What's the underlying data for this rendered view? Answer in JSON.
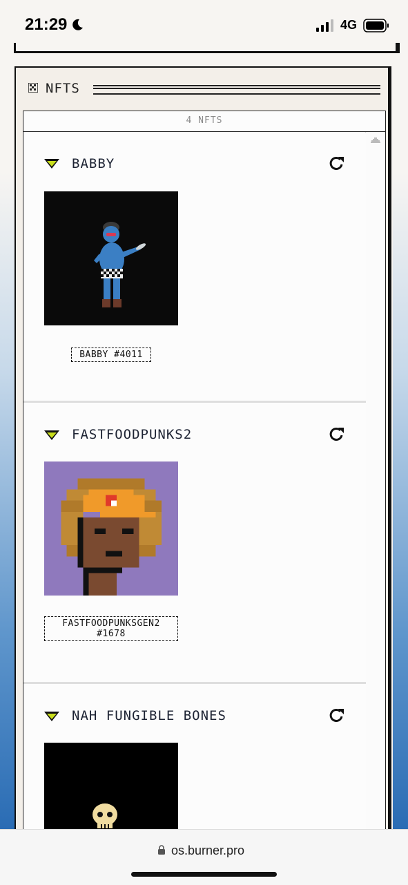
{
  "status_bar": {
    "time": "21:29",
    "network": "4G",
    "icons": [
      "moon-icon",
      "signal-icon",
      "battery-icon"
    ]
  },
  "window": {
    "title": "NFTS",
    "icon": "grid-icon",
    "count_label": "4 NFTS"
  },
  "collections": [
    {
      "name": "BABBY",
      "items": [
        {
          "label": "BABBY #4011",
          "image": "blue figure with checkered shorts on black background"
        }
      ]
    },
    {
      "name": "FASTFOODPUNKS2",
      "items": [
        {
          "label": "FASTFOODPUNKSGEN2 #1678",
          "image": "pixel punk with orange cap on purple background"
        }
      ]
    },
    {
      "name": "NAH FUNGIBLE BONES",
      "items": [
        {
          "label": "",
          "image": "skull on black background"
        }
      ]
    }
  ],
  "browser": {
    "url": "os.burner.pro"
  },
  "colors": {
    "accent_yellow_green": "#c8dd1c",
    "frame_border": "#111111",
    "window_bg": "#f3efe9",
    "punk_background": "#8f79bd"
  }
}
